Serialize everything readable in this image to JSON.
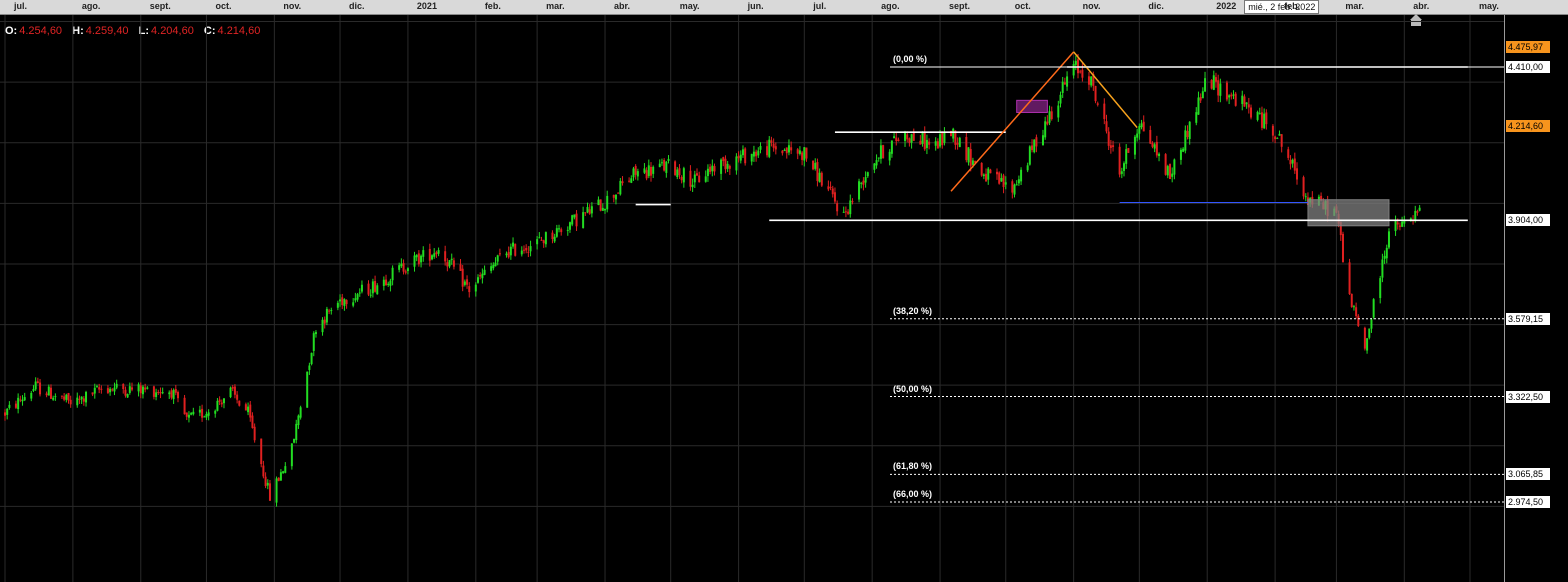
{
  "ohlc": {
    "open_label": "O:",
    "open": "4.254,60",
    "high_label": "H:",
    "high": "4.259,40",
    "low_label": "L:",
    "low": "4.204,60",
    "close_label": "C:",
    "close": "4.214,60"
  },
  "crosshair_date": "mié., 2 feb. 2022",
  "chart_data": {
    "type": "candlestick",
    "title": "",
    "x_ticks": [
      "jul.",
      "ago.",
      "sept.",
      "oct.",
      "nov.",
      "dic.",
      "2021",
      "feb.",
      "mar.",
      "abr.",
      "may.",
      "jun.",
      "jul.",
      "ago.",
      "sept.",
      "oct.",
      "nov.",
      "dic.",
      "2022",
      "feb.",
      "mar.",
      "abr.",
      "may."
    ],
    "y_labels": [
      {
        "text": "4.475,97",
        "value": 4475.97,
        "style": "orange"
      },
      {
        "text": "4.410,00",
        "value": 4410.0,
        "style": "white"
      },
      {
        "text": "4.214,60",
        "value": 4214.6,
        "style": "orange"
      },
      {
        "text": "3.904,00",
        "value": 3904.0,
        "style": "white"
      },
      {
        "text": "3.579,15",
        "value": 3579.15,
        "style": "white"
      },
      {
        "text": "3.322,50",
        "value": 3322.5,
        "style": "white"
      },
      {
        "text": "3.065,85",
        "value": 3065.85,
        "style": "white"
      },
      {
        "text": "2.974,50",
        "value": 2974.5,
        "style": "white"
      }
    ],
    "ylim": [
      2880,
      4580
    ],
    "grid": true,
    "colors": {
      "up": "#22dd22",
      "down": "#e02020",
      "background": "#000000",
      "grid": "#2a2a2a"
    },
    "fibonacci_levels": [
      {
        "label": "(0,00 %)",
        "value": 4410.0
      },
      {
        "label": "(38,20 %)",
        "value": 3579.15
      },
      {
        "label": "(50,00 %)",
        "value": 3322.5
      },
      {
        "label": "(61,80 %)",
        "value": 3065.85
      },
      {
        "label": "(66,00 %)",
        "value": 2974.5
      }
    ],
    "horizontal_lines": [
      {
        "value": 4410.0,
        "from": "2021-10-29",
        "to": "2022-04-30",
        "color": "#ffffff"
      },
      {
        "value": 3904.0,
        "from": "2021-06-15",
        "to": "2022-04-30",
        "color": "#ffffff"
      },
      {
        "value": 4195.0,
        "from": "2021-07-15",
        "to": "2021-10-01",
        "color": "#ffffff"
      },
      {
        "value": 3956.0,
        "from": "2021-04-15",
        "to": "2021-05-01",
        "color": "#ffffff"
      },
      {
        "value": 3963.0,
        "from": "2021-11-22",
        "to": "2022-02-16",
        "color": "#3355ff"
      }
    ],
    "trend_lines": [
      {
        "from": [
          "2021-09-06",
          4000
        ],
        "to": [
          "2021-11-01",
          4460
        ],
        "color": "#ff6a1a"
      },
      {
        "from": [
          "2021-11-01",
          4460
        ],
        "to": [
          "2021-11-30",
          4210
        ],
        "color": "#f7a21d"
      }
    ],
    "rects": [
      {
        "from": "2021-10-06",
        "to": "2021-10-20",
        "top": 4300,
        "bottom": 4260,
        "color": "#b030b0"
      },
      {
        "from": "2022-02-16",
        "to": "2022-03-25",
        "top": 3972,
        "bottom": 3886,
        "color": "#808080"
      }
    ],
    "price_path": [
      [
        "2020-07-01",
        3268
      ],
      [
        "2020-07-15",
        3355
      ],
      [
        "2020-08-01",
        3298
      ],
      [
        "2020-08-15",
        3352
      ],
      [
        "2020-09-01",
        3345
      ],
      [
        "2020-09-15",
        3340
      ],
      [
        "2020-09-22",
        3245
      ],
      [
        "2020-10-01",
        3272
      ],
      [
        "2020-10-12",
        3338
      ],
      [
        "2020-10-20",
        3268
      ],
      [
        "2020-10-30",
        2990
      ],
      [
        "2020-11-09",
        3150
      ],
      [
        "2020-11-20",
        3555
      ],
      [
        "2020-12-01",
        3640
      ],
      [
        "2020-12-15",
        3682
      ],
      [
        "2021-01-01",
        3760
      ],
      [
        "2021-01-15",
        3810
      ],
      [
        "2021-01-29",
        3675
      ],
      [
        "2021-02-15",
        3800
      ],
      [
        "2021-03-01",
        3830
      ],
      [
        "2021-03-15",
        3890
      ],
      [
        "2021-04-01",
        3965
      ],
      [
        "2021-04-15",
        4060
      ],
      [
        "2021-05-01",
        4085
      ],
      [
        "2021-05-12",
        4030
      ],
      [
        "2021-05-20",
        4080
      ],
      [
        "2021-06-01",
        4110
      ],
      [
        "2021-06-15",
        4145
      ],
      [
        "2021-07-01",
        4125
      ],
      [
        "2021-07-19",
        3920
      ],
      [
        "2021-08-01",
        4100
      ],
      [
        "2021-08-15",
        4190
      ],
      [
        "2021-08-30",
        4150
      ],
      [
        "2021-09-06",
        4200
      ],
      [
        "2021-09-20",
        4060
      ],
      [
        "2021-10-04",
        4005
      ],
      [
        "2021-10-18",
        4210
      ],
      [
        "2021-11-01",
        4410
      ],
      [
        "2021-11-08",
        4380
      ],
      [
        "2021-11-22",
        4060
      ],
      [
        "2021-12-01",
        4230
      ],
      [
        "2021-12-15",
        4050
      ],
      [
        "2022-01-01",
        4370
      ],
      [
        "2022-01-15",
        4300
      ],
      [
        "2022-02-01",
        4200
      ],
      [
        "2022-02-16",
        3975
      ],
      [
        "2022-03-01",
        3930
      ],
      [
        "2022-03-07",
        3650
      ],
      [
        "2022-03-14",
        3480
      ],
      [
        "2022-03-25",
        3870
      ],
      [
        "2022-04-01",
        3890
      ],
      [
        "2022-04-08",
        3930
      ]
    ]
  }
}
